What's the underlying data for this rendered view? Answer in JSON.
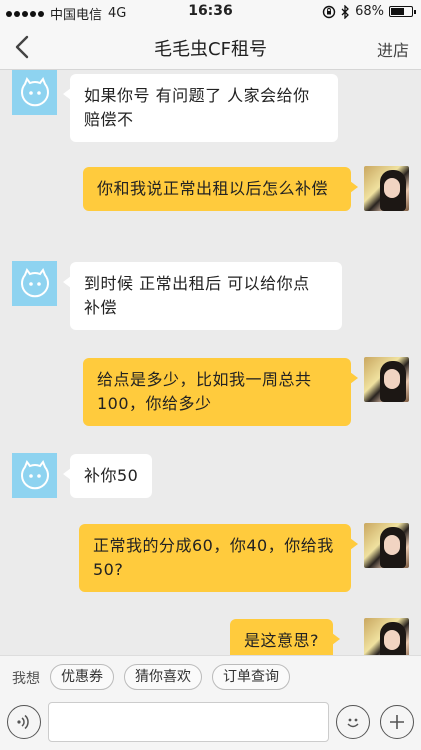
{
  "status_bar": {
    "carrier": "中国电信",
    "network": "4G",
    "time": "16:36",
    "battery": "68%",
    "battery_level": 0.68
  },
  "nav": {
    "title": "毛毛虫CF租号",
    "right_action": "进店"
  },
  "messages": [
    {
      "from": "shop",
      "text": "如果你号  有问题了  人家会给你  赔偿不"
    },
    {
      "from": "user",
      "text": "你和我说正常出租以后怎么补偿"
    },
    {
      "from": "shop",
      "text": "到时候  正常出租后   可以给你点 补偿"
    },
    {
      "from": "user",
      "text": "给点是多少，比如我一周总共100，你给多少"
    },
    {
      "from": "shop",
      "text": "补你50"
    },
    {
      "from": "user",
      "text": "正常我的分成60，你40，你给我50?"
    },
    {
      "from": "user",
      "text": "是这意思?"
    }
  ],
  "quick_replies": {
    "label": "我想",
    "chips": [
      "优惠券",
      "猜你喜欢",
      "订单查询"
    ]
  },
  "input": {
    "placeholder": ""
  },
  "colors": {
    "shop_bubble": "#ffffff",
    "user_bubble": "#ffcb3d",
    "shop_avatar": "#8ed3f0",
    "background": "#ebebeb"
  },
  "icons": {
    "back": "chevron-left-icon",
    "voice": "voice-icon",
    "emoji": "emoji-icon",
    "plus": "plus-icon",
    "bluetooth": "bluetooth-icon",
    "rotation_lock": "rotation-lock-icon"
  }
}
